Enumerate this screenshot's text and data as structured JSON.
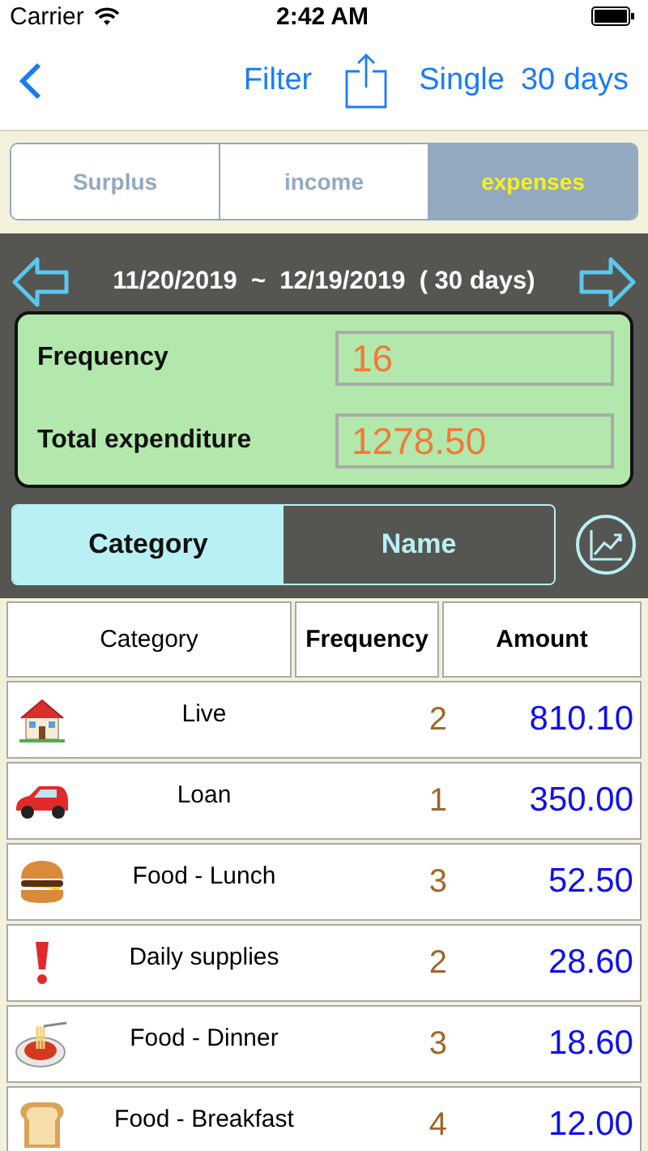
{
  "status_bar": {
    "carrier": "Carrier",
    "time": "2:42 AM"
  },
  "nav_bar": {
    "filter": "Filter",
    "mode": "Single",
    "period": "30 days"
  },
  "segments": [
    {
      "label": "Surplus",
      "selected": false
    },
    {
      "label": "income",
      "selected": false
    },
    {
      "label": "expenses",
      "selected": true
    }
  ],
  "date_range": "11/20/2019  ~  12/19/2019  ( 30 days)",
  "summary": [
    {
      "label": "Frequency",
      "value": "16"
    },
    {
      "label": "Total expenditure",
      "value": "1278.50"
    }
  ],
  "group_tabs": [
    {
      "label": "Category",
      "selected": true
    },
    {
      "label": "Name",
      "selected": false
    }
  ],
  "table": {
    "columns": [
      "Category",
      "Frequency",
      "Amount"
    ],
    "rows": [
      {
        "kind": "house",
        "category": "Live",
        "frequency": "2",
        "amount": "810.10"
      },
      {
        "kind": "car",
        "category": "Loan",
        "frequency": "1",
        "amount": "350.00"
      },
      {
        "kind": "burger",
        "category": "Food - Lunch",
        "frequency": "3",
        "amount": "52.50"
      },
      {
        "kind": "exclamation",
        "category": "Daily supplies",
        "frequency": "2",
        "amount": "28.60"
      },
      {
        "kind": "pasta",
        "category": "Food - Dinner",
        "frequency": "3",
        "amount": "18.60"
      },
      {
        "kind": "bread",
        "category": "Food - Breakfast",
        "frequency": "4",
        "amount": "12.00"
      }
    ]
  }
}
